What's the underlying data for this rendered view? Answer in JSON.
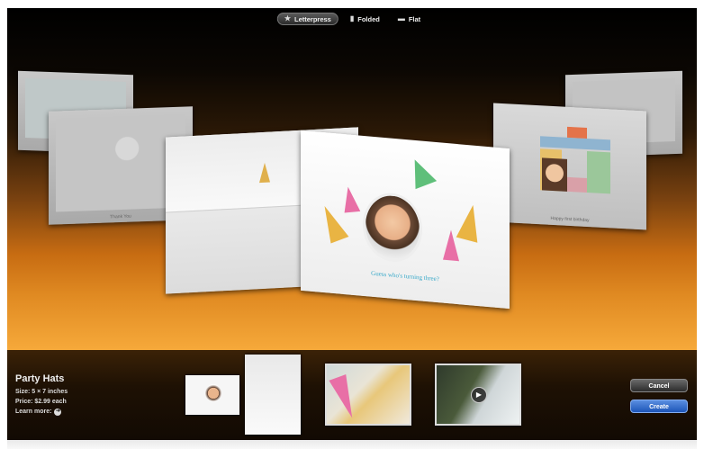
{
  "segmented": {
    "items": [
      {
        "label": "Letterpress",
        "icon": "star-icon",
        "active": true
      },
      {
        "label": "Folded",
        "icon": "folded-card-icon",
        "active": false
      },
      {
        "label": "Flat",
        "icon": "flat-card-icon",
        "active": false
      }
    ]
  },
  "showcase": {
    "left_back_caption": "Thank You",
    "right_back_caption": "Happy first birthday",
    "front_card_caption": "Guess who's turning three?"
  },
  "product": {
    "title": "Party Hats",
    "size": "Size: 5 × 7 inches",
    "price": "Price: $2.99 each",
    "learn_more": "Learn more:"
  },
  "thumbnails": [
    {
      "name": "folded-card-preview"
    },
    {
      "name": "paper-closeup-preview"
    },
    {
      "name": "video-preview"
    }
  ],
  "buttons": {
    "cancel": "Cancel",
    "create": "Create"
  },
  "colors": {
    "accent_blue": "#2a62c4",
    "stage_orange": "#e08a22"
  }
}
